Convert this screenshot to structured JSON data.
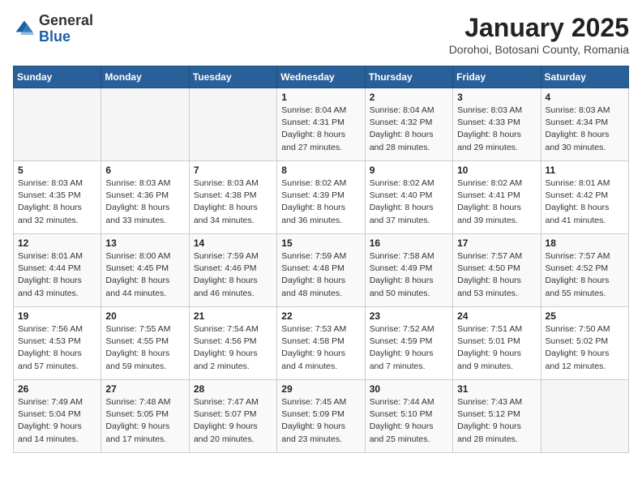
{
  "header": {
    "logo_general": "General",
    "logo_blue": "Blue",
    "title": "January 2025",
    "subtitle": "Dorohoi, Botosani County, Romania"
  },
  "days_of_week": [
    "Sunday",
    "Monday",
    "Tuesday",
    "Wednesday",
    "Thursday",
    "Friday",
    "Saturday"
  ],
  "weeks": [
    [
      {
        "day": "",
        "info": ""
      },
      {
        "day": "",
        "info": ""
      },
      {
        "day": "",
        "info": ""
      },
      {
        "day": "1",
        "info": "Sunrise: 8:04 AM\nSunset: 4:31 PM\nDaylight: 8 hours\nand 27 minutes."
      },
      {
        "day": "2",
        "info": "Sunrise: 8:04 AM\nSunset: 4:32 PM\nDaylight: 8 hours\nand 28 minutes."
      },
      {
        "day": "3",
        "info": "Sunrise: 8:03 AM\nSunset: 4:33 PM\nDaylight: 8 hours\nand 29 minutes."
      },
      {
        "day": "4",
        "info": "Sunrise: 8:03 AM\nSunset: 4:34 PM\nDaylight: 8 hours\nand 30 minutes."
      }
    ],
    [
      {
        "day": "5",
        "info": "Sunrise: 8:03 AM\nSunset: 4:35 PM\nDaylight: 8 hours\nand 32 minutes."
      },
      {
        "day": "6",
        "info": "Sunrise: 8:03 AM\nSunset: 4:36 PM\nDaylight: 8 hours\nand 33 minutes."
      },
      {
        "day": "7",
        "info": "Sunrise: 8:03 AM\nSunset: 4:38 PM\nDaylight: 8 hours\nand 34 minutes."
      },
      {
        "day": "8",
        "info": "Sunrise: 8:02 AM\nSunset: 4:39 PM\nDaylight: 8 hours\nand 36 minutes."
      },
      {
        "day": "9",
        "info": "Sunrise: 8:02 AM\nSunset: 4:40 PM\nDaylight: 8 hours\nand 37 minutes."
      },
      {
        "day": "10",
        "info": "Sunrise: 8:02 AM\nSunset: 4:41 PM\nDaylight: 8 hours\nand 39 minutes."
      },
      {
        "day": "11",
        "info": "Sunrise: 8:01 AM\nSunset: 4:42 PM\nDaylight: 8 hours\nand 41 minutes."
      }
    ],
    [
      {
        "day": "12",
        "info": "Sunrise: 8:01 AM\nSunset: 4:44 PM\nDaylight: 8 hours\nand 43 minutes."
      },
      {
        "day": "13",
        "info": "Sunrise: 8:00 AM\nSunset: 4:45 PM\nDaylight: 8 hours\nand 44 minutes."
      },
      {
        "day": "14",
        "info": "Sunrise: 7:59 AM\nSunset: 4:46 PM\nDaylight: 8 hours\nand 46 minutes."
      },
      {
        "day": "15",
        "info": "Sunrise: 7:59 AM\nSunset: 4:48 PM\nDaylight: 8 hours\nand 48 minutes."
      },
      {
        "day": "16",
        "info": "Sunrise: 7:58 AM\nSunset: 4:49 PM\nDaylight: 8 hours\nand 50 minutes."
      },
      {
        "day": "17",
        "info": "Sunrise: 7:57 AM\nSunset: 4:50 PM\nDaylight: 8 hours\nand 53 minutes."
      },
      {
        "day": "18",
        "info": "Sunrise: 7:57 AM\nSunset: 4:52 PM\nDaylight: 8 hours\nand 55 minutes."
      }
    ],
    [
      {
        "day": "19",
        "info": "Sunrise: 7:56 AM\nSunset: 4:53 PM\nDaylight: 8 hours\nand 57 minutes."
      },
      {
        "day": "20",
        "info": "Sunrise: 7:55 AM\nSunset: 4:55 PM\nDaylight: 8 hours\nand 59 minutes."
      },
      {
        "day": "21",
        "info": "Sunrise: 7:54 AM\nSunset: 4:56 PM\nDaylight: 9 hours\nand 2 minutes."
      },
      {
        "day": "22",
        "info": "Sunrise: 7:53 AM\nSunset: 4:58 PM\nDaylight: 9 hours\nand 4 minutes."
      },
      {
        "day": "23",
        "info": "Sunrise: 7:52 AM\nSunset: 4:59 PM\nDaylight: 9 hours\nand 7 minutes."
      },
      {
        "day": "24",
        "info": "Sunrise: 7:51 AM\nSunset: 5:01 PM\nDaylight: 9 hours\nand 9 minutes."
      },
      {
        "day": "25",
        "info": "Sunrise: 7:50 AM\nSunset: 5:02 PM\nDaylight: 9 hours\nand 12 minutes."
      }
    ],
    [
      {
        "day": "26",
        "info": "Sunrise: 7:49 AM\nSunset: 5:04 PM\nDaylight: 9 hours\nand 14 minutes."
      },
      {
        "day": "27",
        "info": "Sunrise: 7:48 AM\nSunset: 5:05 PM\nDaylight: 9 hours\nand 17 minutes."
      },
      {
        "day": "28",
        "info": "Sunrise: 7:47 AM\nSunset: 5:07 PM\nDaylight: 9 hours\nand 20 minutes."
      },
      {
        "day": "29",
        "info": "Sunrise: 7:45 AM\nSunset: 5:09 PM\nDaylight: 9 hours\nand 23 minutes."
      },
      {
        "day": "30",
        "info": "Sunrise: 7:44 AM\nSunset: 5:10 PM\nDaylight: 9 hours\nand 25 minutes."
      },
      {
        "day": "31",
        "info": "Sunrise: 7:43 AM\nSunset: 5:12 PM\nDaylight: 9 hours\nand 28 minutes."
      },
      {
        "day": "",
        "info": ""
      }
    ]
  ]
}
